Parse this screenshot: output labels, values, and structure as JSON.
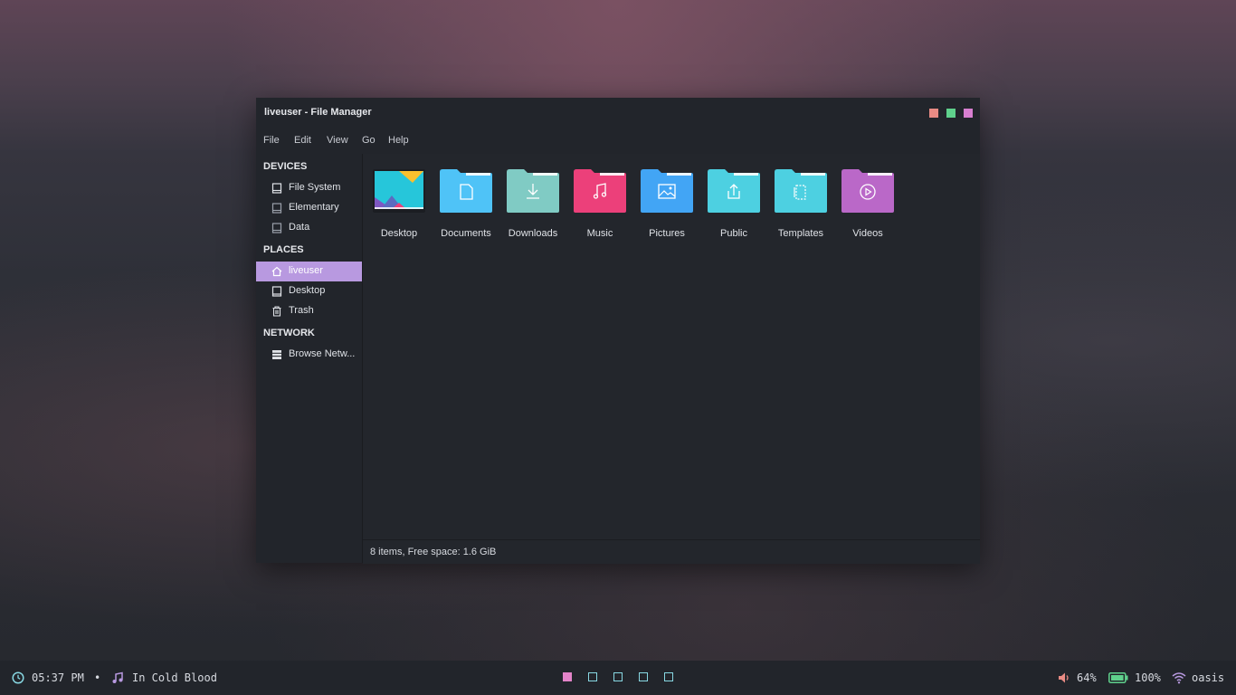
{
  "window": {
    "title": "liveuser - File Manager",
    "controls": {
      "minimize_color": "#e88b84",
      "maximize_color": "#5fd18c",
      "close_color": "#d77fd0"
    }
  },
  "menubar": [
    "File",
    "Edit",
    "View",
    "Go",
    "Help"
  ],
  "sidebar": {
    "devices_title": "DEVICES",
    "devices": [
      {
        "label": "File System",
        "icon": "drive-icon"
      },
      {
        "label": "Elementary",
        "icon": "drive-icon"
      },
      {
        "label": "Data",
        "icon": "drive-icon"
      }
    ],
    "places_title": "PLACES",
    "places": [
      {
        "label": "liveuser",
        "icon": "home-icon",
        "active": true
      },
      {
        "label": "Desktop",
        "icon": "desktop-icon"
      },
      {
        "label": "Trash",
        "icon": "trash-icon"
      }
    ],
    "network_title": "NETWORK",
    "network": [
      {
        "label": "Browse Netw...",
        "icon": "network-icon"
      }
    ]
  },
  "files": [
    {
      "label": "Desktop",
      "icon": "desktop-folder-icon"
    },
    {
      "label": "Documents",
      "icon": "documents-folder-icon",
      "color": "#4fc3f7"
    },
    {
      "label": "Downloads",
      "icon": "downloads-folder-icon",
      "color": "#80cbc4"
    },
    {
      "label": "Music",
      "icon": "music-folder-icon",
      "color": "#ec407a"
    },
    {
      "label": "Pictures",
      "icon": "pictures-folder-icon",
      "color": "#42a5f5"
    },
    {
      "label": "Public",
      "icon": "public-folder-icon",
      "color": "#4dd0e1"
    },
    {
      "label": "Templates",
      "icon": "templates-folder-icon",
      "color": "#4dd0e1"
    },
    {
      "label": "Videos",
      "icon": "videos-folder-icon",
      "color": "#ba68c8"
    }
  ],
  "statusbar": {
    "text": "8 items, Free space: 1.6 GiB"
  },
  "panel": {
    "clock": "05:37 PM",
    "separator": "•",
    "now_playing": "In Cold Blood",
    "workspaces": [
      {
        "active": true
      },
      {
        "active": false
      },
      {
        "active": false
      },
      {
        "active": false
      },
      {
        "active": false
      }
    ],
    "volume": "64%",
    "battery": "100%",
    "wifi": "oasis",
    "accent": "#e384c9"
  }
}
